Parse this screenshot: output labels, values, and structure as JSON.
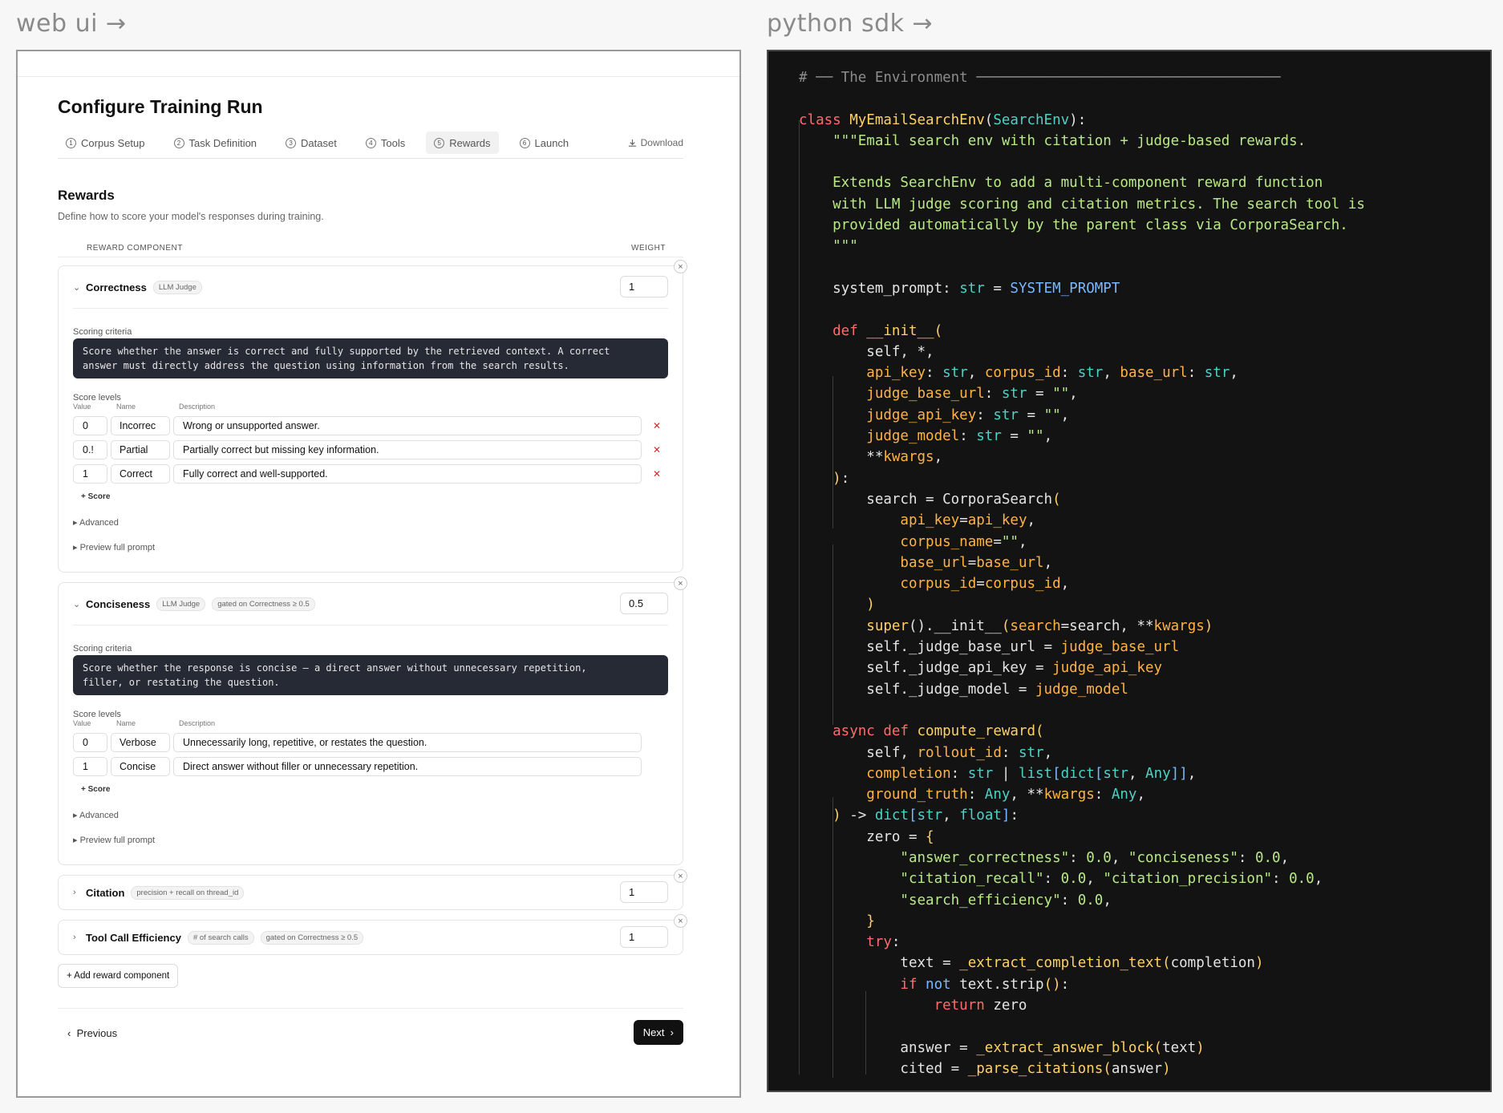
{
  "headers": {
    "left": "web ui →",
    "right": "python sdk →"
  },
  "web": {
    "title": "Configure Training Run",
    "tabs": [
      {
        "num": "1",
        "label": "Corpus Setup"
      },
      {
        "num": "2",
        "label": "Task Definition"
      },
      {
        "num": "3",
        "label": "Dataset"
      },
      {
        "num": "4",
        "label": "Tools"
      },
      {
        "num": "5",
        "label": "Rewards",
        "active": true
      },
      {
        "num": "6",
        "label": "Launch"
      }
    ],
    "download_label": "Download",
    "section_title": "Rewards",
    "section_subtitle": "Define how to score your model's responses during training.",
    "col_component": "REWARD COMPONENT",
    "col_weight": "WEIGHT",
    "scoring_criteria_label": "Scoring criteria",
    "score_levels_label": "Score levels",
    "col_value": "Value",
    "col_name": "Name",
    "col_description": "Description",
    "add_score_label": "+ Score",
    "advanced_label": "Advanced",
    "preview_label": "Preview full prompt",
    "components": [
      {
        "name": "Correctness",
        "tags": [
          "LLM Judge"
        ],
        "weight": "1",
        "criteria": "Score whether the answer is correct and fully supported by the retrieved context. A correct\nanswer must directly address the question using information from the search results.",
        "levels": [
          {
            "value": "0",
            "name": "Incorrec",
            "description": "Wrong or unsupported answer."
          },
          {
            "value": "0.!",
            "name": "Partial",
            "description": "Partially correct but missing key information."
          },
          {
            "value": "1",
            "name": "Correct",
            "description": "Fully correct and well-supported."
          }
        ]
      },
      {
        "name": "Conciseness",
        "tags": [
          "LLM Judge",
          "gated on Correctness ≥ 0.5"
        ],
        "weight": "0.5",
        "criteria": "Score whether the response is concise — a direct answer without unnecessary repetition,\nfiller, or restating the question.",
        "levels": [
          {
            "value": "0",
            "name": "Verbose",
            "description": "Unnecessarily long, repetitive, or restates the question."
          },
          {
            "value": "1",
            "name": "Concise",
            "description": "Direct answer without filler or unnecessary repetition."
          }
        ]
      },
      {
        "name": "Citation",
        "tags": [
          "precision + recall on thread_id"
        ],
        "weight": "1"
      },
      {
        "name": "Tool Call Efficiency",
        "tags": [
          "# of search calls",
          "gated on Correctness ≥ 0.5"
        ],
        "weight": "1"
      }
    ],
    "add_component_label": "+ Add reward component",
    "previous_label": "Previous",
    "next_label": "Next"
  },
  "code_lines": [
    [
      [
        "c-com",
        "# ── The Environment ────────────────────────────────────"
      ]
    ],
    [],
    [
      [
        "c-kw",
        "class "
      ],
      [
        "c-cls",
        "MyEmailSearchEnv"
      ],
      [
        "",
        "("
      ],
      [
        "c-type",
        "SearchEnv"
      ],
      [
        "",
        "):"
      ]
    ],
    [
      [
        "c-str",
        "    \"\"\"Email search env with citation + judge-based rewards."
      ]
    ],
    [],
    [
      [
        "c-str",
        "    Extends SearchEnv to add a multi-component reward function"
      ]
    ],
    [
      [
        "c-str",
        "    with LLM judge scoring and citation metrics. The search tool is"
      ]
    ],
    [
      [
        "c-str",
        "    provided automatically by the parent class via CorporaSearch."
      ]
    ],
    [
      [
        "c-str",
        "    \"\"\""
      ]
    ],
    [],
    [
      [
        "",
        "    system_prompt: "
      ],
      [
        "c-type",
        "str"
      ],
      [
        "",
        " = "
      ],
      [
        "c-const",
        "SYSTEM_PROMPT"
      ]
    ],
    [],
    [
      [
        "c-kw",
        "    def "
      ],
      [
        "c-fn",
        "__init__"
      ],
      [
        "c-fn",
        "("
      ]
    ],
    [
      [
        "",
        "        self, *,"
      ]
    ],
    [
      [
        "c-param",
        "        api_key"
      ],
      [
        "",
        ": "
      ],
      [
        "c-type",
        "str"
      ],
      [
        "",
        ", "
      ],
      [
        "c-param",
        "corpus_id"
      ],
      [
        "",
        ": "
      ],
      [
        "c-type",
        "str"
      ],
      [
        "",
        ", "
      ],
      [
        "c-param",
        "base_url"
      ],
      [
        "",
        ": "
      ],
      [
        "c-type",
        "str"
      ],
      [
        "",
        ","
      ]
    ],
    [
      [
        "c-param",
        "        judge_base_url"
      ],
      [
        "",
        ": "
      ],
      [
        "c-type",
        "str"
      ],
      [
        "",
        " = "
      ],
      [
        "c-str",
        "\"\""
      ],
      [
        "",
        ","
      ]
    ],
    [
      [
        "c-param",
        "        judge_api_key"
      ],
      [
        "",
        ": "
      ],
      [
        "c-type",
        "str"
      ],
      [
        "",
        " = "
      ],
      [
        "c-str",
        "\"\""
      ],
      [
        "",
        ","
      ]
    ],
    [
      [
        "c-param",
        "        judge_model"
      ],
      [
        "",
        ": "
      ],
      [
        "c-type",
        "str"
      ],
      [
        "",
        " = "
      ],
      [
        "c-str",
        "\"\""
      ],
      [
        "",
        ","
      ]
    ],
    [
      [
        "",
        "        **"
      ],
      [
        "c-param",
        "kwargs"
      ],
      [
        "",
        ","
      ]
    ],
    [
      [
        "c-fn",
        "    )"
      ],
      [
        "",
        ":"
      ]
    ],
    [
      [
        "",
        "        search = CorporaSearch"
      ],
      [
        "c-fn",
        "("
      ]
    ],
    [
      [
        "c-param",
        "            api_key"
      ],
      [
        "",
        "="
      ],
      [
        "c-param",
        "api_key"
      ],
      [
        "",
        ","
      ]
    ],
    [
      [
        "c-param",
        "            corpus_name"
      ],
      [
        "",
        "="
      ],
      [
        "c-str",
        "\"\""
      ],
      [
        "",
        ","
      ]
    ],
    [
      [
        "c-param",
        "            base_url"
      ],
      [
        "",
        "="
      ],
      [
        "c-param",
        "base_url"
      ],
      [
        "",
        ","
      ]
    ],
    [
      [
        "c-param",
        "            corpus_id"
      ],
      [
        "",
        "="
      ],
      [
        "c-param",
        "corpus_id"
      ],
      [
        "",
        ","
      ]
    ],
    [
      [
        "c-fn",
        "        )"
      ]
    ],
    [
      [
        "c-fn",
        "        super"
      ],
      [
        "",
        "()."
      ],
      [
        "",
        "__init__"
      ],
      [
        "c-fn",
        "("
      ],
      [
        "c-param",
        "search"
      ],
      [
        "",
        "=search, **"
      ],
      [
        "c-param",
        "kwargs"
      ],
      [
        "c-fn",
        ")"
      ]
    ],
    [
      [
        "",
        "        self._judge_base_url = "
      ],
      [
        "c-param",
        "judge_base_url"
      ]
    ],
    [
      [
        "",
        "        self._judge_api_key = "
      ],
      [
        "c-param",
        "judge_api_key"
      ]
    ],
    [
      [
        "",
        "        self._judge_model = "
      ],
      [
        "c-param",
        "judge_model"
      ]
    ],
    [],
    [
      [
        "c-kw",
        "    async def "
      ],
      [
        "c-fn",
        "compute_reward"
      ],
      [
        "c-fn",
        "("
      ]
    ],
    [
      [
        "",
        "        self, "
      ],
      [
        "c-param",
        "rollout_id"
      ],
      [
        "",
        ": "
      ],
      [
        "c-type",
        "str"
      ],
      [
        "",
        ","
      ]
    ],
    [
      [
        "c-param",
        "        completion"
      ],
      [
        "",
        ": "
      ],
      [
        "c-type",
        "str"
      ],
      [
        "",
        " | "
      ],
      [
        "c-type",
        "list"
      ],
      [
        "c-blue",
        "["
      ],
      [
        "c-type",
        "dict"
      ],
      [
        "c-blue",
        "["
      ],
      [
        "c-type",
        "str"
      ],
      [
        "",
        ", "
      ],
      [
        "c-type",
        "Any"
      ],
      [
        "c-blue",
        "]]"
      ],
      [
        "",
        ","
      ]
    ],
    [
      [
        "c-param",
        "        ground_truth"
      ],
      [
        "",
        ": "
      ],
      [
        "c-type",
        "Any"
      ],
      [
        "",
        ", **"
      ],
      [
        "c-param",
        "kwargs"
      ],
      [
        "",
        ": "
      ],
      [
        "c-type",
        "Any"
      ],
      [
        "",
        ","
      ]
    ],
    [
      [
        "c-fn",
        "    )"
      ],
      [
        "",
        " -> "
      ],
      [
        "c-type",
        "dict"
      ],
      [
        "c-blue",
        "["
      ],
      [
        "c-type",
        "str"
      ],
      [
        "",
        ", "
      ],
      [
        "c-type",
        "float"
      ],
      [
        "c-blue",
        "]"
      ],
      [
        "",
        ":"
      ]
    ],
    [
      [
        "",
        "        zero = "
      ],
      [
        "c-fn",
        "{"
      ]
    ],
    [
      [
        "c-str",
        "            \"answer_correctness\""
      ],
      [
        "",
        ": "
      ],
      [
        "c-num",
        "0.0"
      ],
      [
        "",
        ", "
      ],
      [
        "c-str",
        "\"conciseness\""
      ],
      [
        "",
        ": "
      ],
      [
        "c-num",
        "0.0"
      ],
      [
        "",
        ","
      ]
    ],
    [
      [
        "c-str",
        "            \"citation_recall\""
      ],
      [
        "",
        ": "
      ],
      [
        "c-num",
        "0.0"
      ],
      [
        "",
        ", "
      ],
      [
        "c-str",
        "\"citation_precision\""
      ],
      [
        "",
        ": "
      ],
      [
        "c-num",
        "0.0"
      ],
      [
        "",
        ","
      ]
    ],
    [
      [
        "c-str",
        "            \"search_efficiency\""
      ],
      [
        "",
        ": "
      ],
      [
        "c-num",
        "0.0"
      ],
      [
        "",
        ","
      ]
    ],
    [
      [
        "c-fn",
        "        }"
      ]
    ],
    [
      [
        "c-kw",
        "        try"
      ],
      [
        "",
        ":"
      ]
    ],
    [
      [
        "",
        "            text = "
      ],
      [
        "c-fn",
        "_extract_completion_text"
      ],
      [
        "c-fn",
        "("
      ],
      [
        "",
        "completion"
      ],
      [
        "c-fn",
        ")"
      ]
    ],
    [
      [
        "c-kw",
        "            if "
      ],
      [
        "c-blue",
        "not "
      ],
      [
        "",
        "text.strip"
      ],
      [
        "c-fn",
        "()"
      ],
      [
        "",
        ":"
      ]
    ],
    [
      [
        "c-kw",
        "                return "
      ],
      [
        "",
        "zero"
      ]
    ],
    [],
    [
      [
        "",
        "            answer = "
      ],
      [
        "c-fn",
        "_extract_answer_block"
      ],
      [
        "c-fn",
        "("
      ],
      [
        "",
        "text"
      ],
      [
        "c-fn",
        ")"
      ]
    ],
    [
      [
        "",
        "            cited = "
      ],
      [
        "c-fn",
        "_parse_citations"
      ],
      [
        "c-fn",
        "("
      ],
      [
        "",
        "answer"
      ],
      [
        "c-fn",
        ")"
      ]
    ]
  ]
}
